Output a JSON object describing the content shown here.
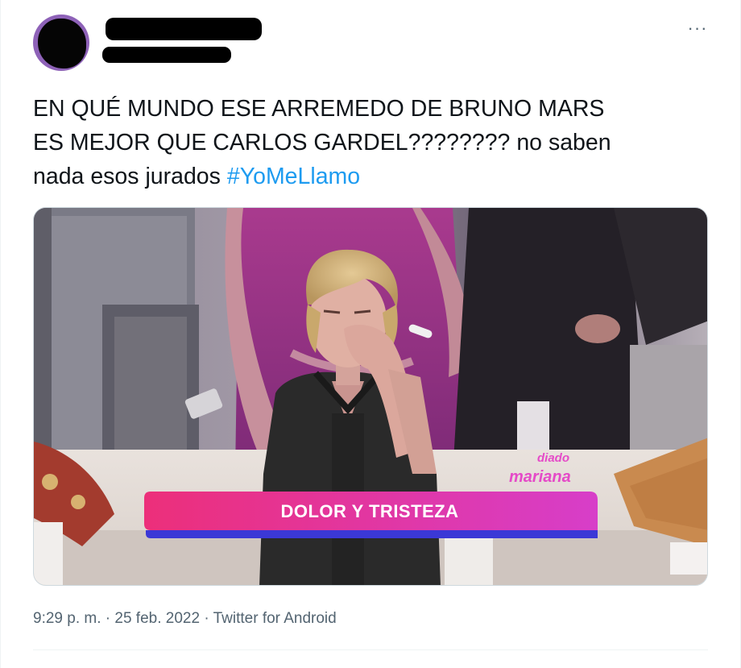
{
  "author": {
    "avatar_icon": "user-avatar-redacted",
    "name_redacted": true
  },
  "more_icon_glyph": "···",
  "tweet": {
    "text_main": "EN QUÉ MUNDO ESE ARREMEDO DE BRUNO MARS\nES MEJOR QUE CARLOS GARDEL???????? no saben\nnada esos jurados ",
    "hashtag": "#YoMeLlamo"
  },
  "media": {
    "banner_label": "DOLOR Y TRISTEZA",
    "brand_top": "diado",
    "brand_bottom": "mariana"
  },
  "meta": {
    "time": "9:29 p. m.",
    "separator": " · ",
    "date": "25 feb. 2022",
    "source": "Twitter for Android"
  },
  "colors": {
    "hashtag": "#1d9bf0",
    "meta_text": "#536471",
    "banner_pink": "#ec2f7a",
    "banner_magenta": "#d73ec9",
    "banner_blue": "#3b38d6"
  }
}
